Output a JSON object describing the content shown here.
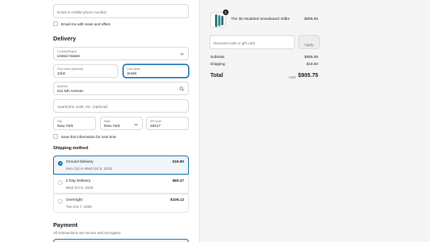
{
  "contact": {
    "email_placeholder": "Email or mobile phone number",
    "news_label": "Email me with news and offers"
  },
  "delivery": {
    "heading": "Delivery",
    "country_label": "Country/Region",
    "country_value": "United States",
    "first_name_label": "First name (optional)",
    "first_name_value": "John",
    "last_name_label": "Last name",
    "last_name_value": "Smith",
    "address_label": "Address",
    "address_value": "511 5th Avenue",
    "apartment_placeholder": "Apartment, suite, etc. (optional)",
    "city_label": "City",
    "city_value": "New York",
    "state_label": "State",
    "state_value": "New York",
    "zip_label": "ZIP code",
    "zip_value": "10017",
    "save_label": "Save this information for next time"
  },
  "shipping": {
    "heading": "Shipping method",
    "options": [
      {
        "name": "Ground Delivery",
        "date": "Mon Oct 6–Wed Oct 8, 2025",
        "price": "$19.80",
        "selected": true
      },
      {
        "name": "2 Day Delivery",
        "date": "Wed Oct 8, 2025",
        "price": "$60.27",
        "selected": false
      },
      {
        "name": "Overnight",
        "date": "Tue Oct 7, 2025",
        "price": "$106.12",
        "selected": false
      }
    ]
  },
  "payment": {
    "heading": "Payment",
    "subtext": "All transactions are secure and encrypted."
  },
  "summary": {
    "product_name": "The 3D Modeled Snowboard 40lbs",
    "product_qty": "1",
    "product_price": "$885.95",
    "discount_placeholder": "Discount code or gift card",
    "apply_label": "Apply",
    "subtotal_label": "Subtotal",
    "subtotal_value": "$885.95",
    "shipping_label": "Shipping",
    "shipping_value": "$19.80",
    "total_label": "Total",
    "currency": "USD",
    "total_value": "$905.75"
  },
  "colors": {
    "accent": "#1773b0",
    "summary_bg": "#f5f5f5"
  }
}
